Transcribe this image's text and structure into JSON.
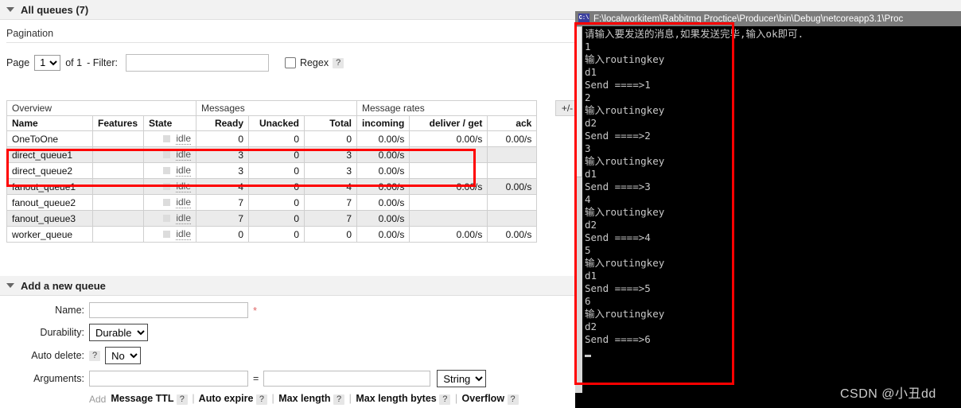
{
  "mgmt": {
    "all_queues_title": "All queues (7)",
    "pagination": {
      "section_label": "Pagination",
      "page_label": "Page",
      "page_value": "1",
      "of_label": "of 1",
      "filter_label": "- Filter:",
      "filter_value": "",
      "filter_placeholder": "",
      "regex_label": "Regex",
      "regex_help": "?",
      "regex_checked": false
    },
    "table": {
      "group_headers": [
        "Overview",
        "Messages",
        "Message rates"
      ],
      "plus_minus": "+/-",
      "columns": [
        "Name",
        "Features",
        "State",
        "Ready",
        "Unacked",
        "Total",
        "incoming",
        "deliver / get",
        "ack"
      ],
      "rows": [
        {
          "name": "OneToOne",
          "features": "",
          "state": "idle",
          "ready": "0",
          "unacked": "0",
          "total": "0",
          "incoming": "0.00/s",
          "deliver_get": "0.00/s",
          "ack": "0.00/s"
        },
        {
          "name": "direct_queue1",
          "features": "",
          "state": "idle",
          "ready": "3",
          "unacked": "0",
          "total": "3",
          "incoming": "0.00/s",
          "deliver_get": "",
          "ack": ""
        },
        {
          "name": "direct_queue2",
          "features": "",
          "state": "idle",
          "ready": "3",
          "unacked": "0",
          "total": "3",
          "incoming": "0.00/s",
          "deliver_get": "",
          "ack": ""
        },
        {
          "name": "fanout_queue1",
          "features": "",
          "state": "idle",
          "ready": "4",
          "unacked": "0",
          "total": "4",
          "incoming": "0.00/s",
          "deliver_get": "0.00/s",
          "ack": "0.00/s"
        },
        {
          "name": "fanout_queue2",
          "features": "",
          "state": "idle",
          "ready": "7",
          "unacked": "0",
          "total": "7",
          "incoming": "0.00/s",
          "deliver_get": "",
          "ack": ""
        },
        {
          "name": "fanout_queue3",
          "features": "",
          "state": "idle",
          "ready": "7",
          "unacked": "0",
          "total": "7",
          "incoming": "0.00/s",
          "deliver_get": "",
          "ack": ""
        },
        {
          "name": "worker_queue",
          "features": "",
          "state": "idle",
          "ready": "0",
          "unacked": "0",
          "total": "0",
          "incoming": "0.00/s",
          "deliver_get": "0.00/s",
          "ack": "0.00/s"
        }
      ]
    },
    "add_queue": {
      "title": "Add a new queue",
      "name_label": "Name:",
      "name_value": "",
      "name_required_mark": "*",
      "durability_label": "Durability:",
      "durability_value": "Durable",
      "auto_delete_label": "Auto delete:",
      "auto_delete_help": "?",
      "auto_delete_value": "No",
      "arguments_label": "Arguments:",
      "arguments_key_value": "",
      "arguments_eq": "=",
      "arguments_val_value": "",
      "arguments_type_value": "String",
      "add_label": "Add",
      "presets": [
        {
          "label": "Message TTL",
          "help": "?"
        },
        {
          "label": "Auto expire",
          "help": "?"
        },
        {
          "label": "Max length",
          "help": "?"
        },
        {
          "label": "Max length bytes",
          "help": "?"
        },
        {
          "label": "Overflow",
          "help": "?"
        }
      ]
    }
  },
  "console": {
    "icon_text": "C:\\",
    "title": "F:\\localworkitem\\Rabbitmq Proctice\\Producer\\bin\\Debug\\netcoreapp3.1\\Proc",
    "output": "请输入要发送的消息,如果发送完毕,输入ok即可.\n1\n输入routingkey\nd1\nSend ====>1\n2\n输入routingkey\nd2\nSend ====>2\n3\n输入routingkey\nd1\nSend ====>3\n4\n输入routingkey\nd2\nSend ====>4\n5\n输入routingkey\nd1\nSend ====>5\n6\n输入routingkey\nd2\nSend ====>6\n"
  },
  "annotations": {
    "highlight_color": "#ff0000",
    "rows_box_note": "direct_queue1 / direct_queue2 highlighted",
    "console_box_note": "console output highlighted"
  },
  "watermark": {
    "text": "CSDN @小丑dd"
  }
}
